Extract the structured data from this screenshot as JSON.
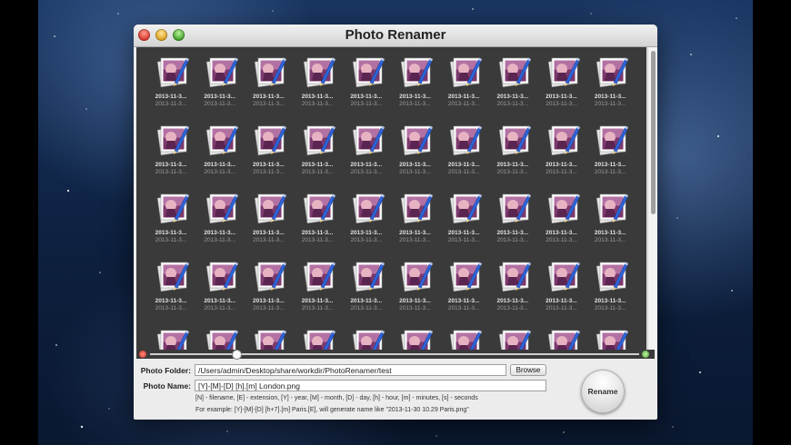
{
  "window": {
    "title": "Photo Renamer"
  },
  "photos": {
    "rows": 5,
    "cols": 10,
    "caption_line1": "2013-11-3...",
    "caption_line2": "2013-11-3..."
  },
  "form": {
    "photo_folder_label": "Photo Folder:",
    "photo_folder_value": "/Users/admin/Desktop/share/workdir/PhotoRenamer/test",
    "browse_label": "Browse",
    "photo_name_label": "Photo Name:",
    "photo_name_value": "[Y]-[M]-[D] [h].[m] London.png",
    "hint_line1": "[N] - filename, [E] - extension, [Y] - year, [M] - month, [D] - day, [h] - hour, [m] - minutes, [s] - seconds",
    "hint_line2": "For example: [Y]-[M]-[D] [h+7].[m] Paris.[E],  will generate name like \"2013-11-30 10.29 Paris.png\"",
    "rename_label": "Rename"
  },
  "colors": {
    "grid_background": "#3a3a3a",
    "window_background": "#ececec"
  },
  "icons": {
    "thumbnail": "photo-with-pen-icon"
  }
}
